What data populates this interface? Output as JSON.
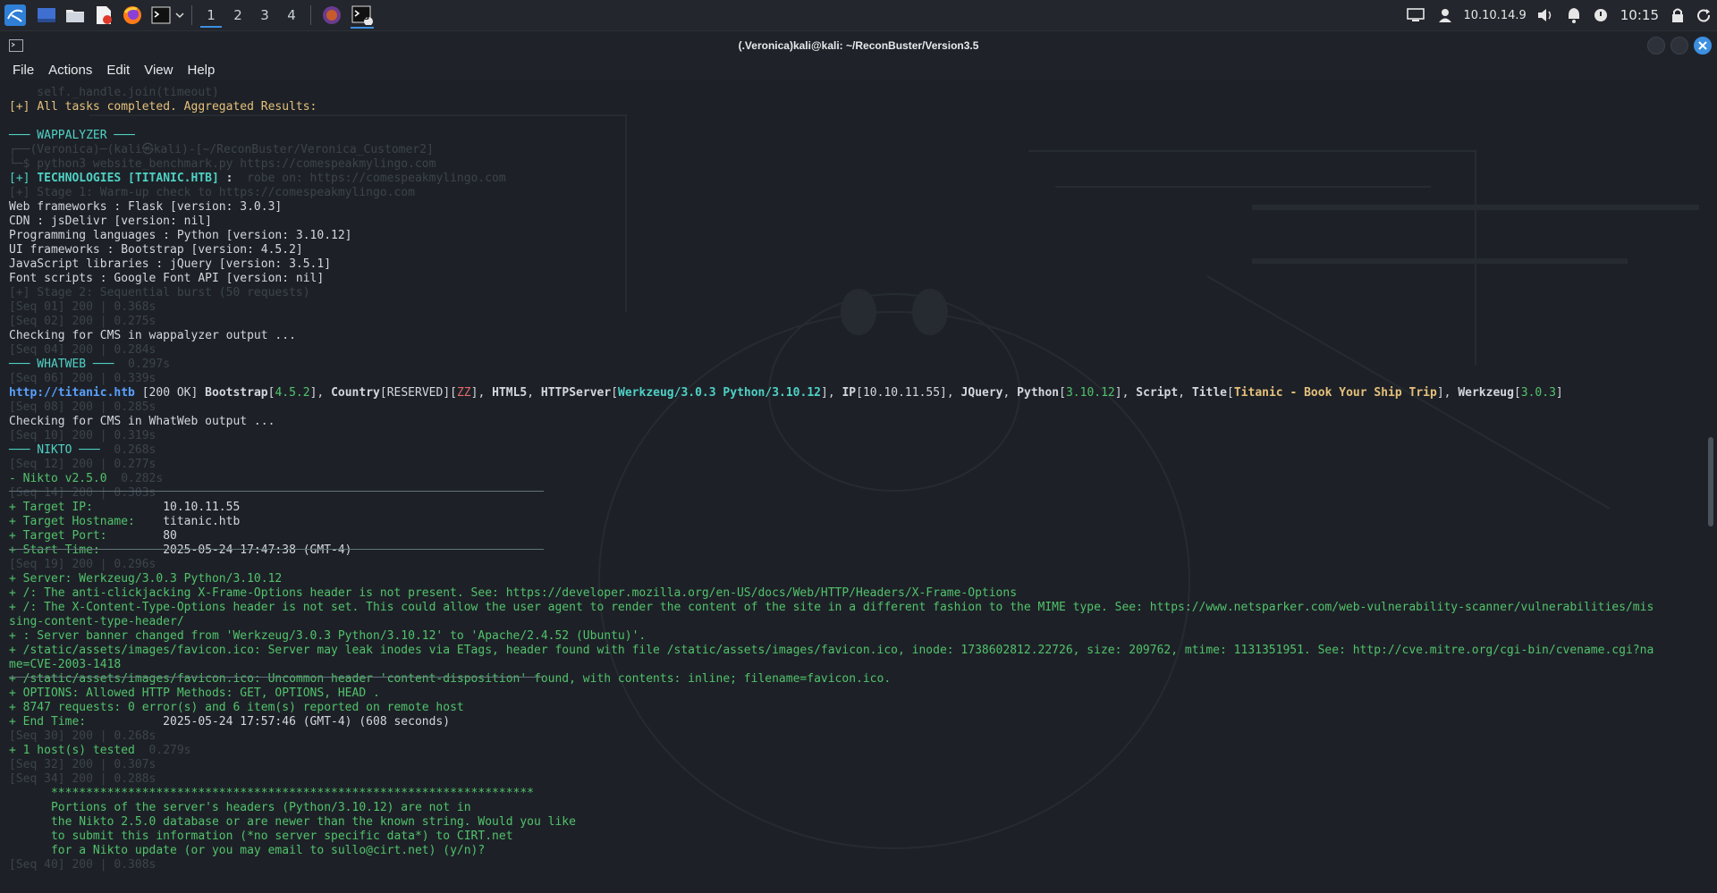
{
  "panel": {
    "workspaces": [
      "1",
      "2",
      "3",
      "4"
    ],
    "active_workspace": "1",
    "terminal_badge": "3",
    "ip": "10.10.14.9",
    "clock": "10:15"
  },
  "window": {
    "title": "(.Veronica)kali@kali: ~/ReconBuster/Version3.5"
  },
  "menu": [
    "File",
    "Actions",
    "Edit",
    "View",
    "Help"
  ],
  "colors": {
    "green": "#52c26b",
    "blue": "#5aa0ff",
    "accent": "#3d8fe0",
    "ghost": "#3c434c"
  },
  "terminal": {
    "lines": [
      {
        "ghost": "    self._handle.join(timeout)"
      },
      {
        "parts": [
          {
            "t": "[+] ",
            "c": "y"
          },
          {
            "t": "All tasks completed. Aggregated Results:",
            "c": "y"
          }
        ]
      },
      {
        "parts": []
      },
      {
        "parts": [
          {
            "t": "─── WAPPALYZER ───",
            "c": "c"
          }
        ]
      },
      {
        "ghost": "┌──(Veronica)─(kali㉿kali)-[~/ReconBuster/Veronica_Customer2]"
      },
      {
        "ghost": "└─$ python3 website_benchmark.py https://comespeakmylingo.com"
      },
      {
        "parts": [
          {
            "t": "[+] ",
            "c": "c"
          },
          {
            "t": "TECHNOLOGIES [TITANIC.HTB] ",
            "c": "c bold"
          },
          {
            "t": ":",
            "c": "bold"
          }
        ],
        "ghost_tail": "  robe on: https://comespeakmylingo.com"
      },
      {
        "ghost": "[+] Stage 1: Warm-up check to https://comespeakmylingo.com"
      },
      {
        "parts": [
          {
            "t": "Web frameworks : Flask [version: 3.0.3]",
            "c": ""
          }
        ]
      },
      {
        "parts": [
          {
            "t": "CDN : jsDelivr [version: nil]",
            "c": ""
          }
        ]
      },
      {
        "parts": [
          {
            "t": "Programming languages : Python [version: 3.10.12]",
            "c": ""
          }
        ]
      },
      {
        "parts": [
          {
            "t": "UI frameworks : Bootstrap [version: 4.5.2]",
            "c": ""
          }
        ]
      },
      {
        "parts": [
          {
            "t": "JavaScript libraries : jQuery [version: 3.5.1]",
            "c": ""
          }
        ]
      },
      {
        "parts": [
          {
            "t": "Font scripts : Google Font API [version: nil]",
            "c": ""
          }
        ]
      },
      {
        "ghost": "[+] Stage 2: Sequential burst (50 requests)"
      },
      {
        "ghost": "[Seq 01] 200 | 0.368s"
      },
      {
        "ghost": "[Seq 02] 200 | 0.275s"
      },
      {
        "parts": [
          {
            "t": "Checking for CMS in wappalyzer output ...",
            "c": ""
          }
        ]
      },
      {
        "ghost": "[Seq 04] 200 | 0.284s"
      },
      {
        "parts": [
          {
            "t": "─── WHATWEB ───",
            "c": "c"
          }
        ],
        "ghost_tail": "  0.297s"
      },
      {
        "ghost": "[Seq 06] 200 | 0.339s"
      },
      {
        "whatweb": true
      },
      {
        "ghost": "[Seq 08] 200 | 0.285s"
      },
      {
        "parts": [
          {
            "t": "Checking for CMS in WhatWeb output ...",
            "c": ""
          }
        ]
      },
      {
        "ghost": "[Seq 10] 200 | 0.319s"
      },
      {
        "parts": [
          {
            "t": "─── NIKTO ───",
            "c": "c"
          }
        ],
        "ghost_tail": "  0.268s"
      },
      {
        "ghost": "[Seq 12] 200 | 0.277s"
      },
      {
        "parts": [
          {
            "t": "- Nikto v2.5.0",
            "c": "g"
          }
        ],
        "ghost_tail": "  0.282s"
      },
      {
        "ghost": "[Seq 14] 200 | 0.303s"
      },
      {
        "parts": [
          {
            "t": "+ Target IP:",
            "c": "g"
          },
          {
            "t": "          10.10.11.55",
            "c": ""
          }
        ]
      },
      {
        "parts": [
          {
            "t": "+ Target Hostname:",
            "c": "g"
          },
          {
            "t": "    titanic.htb",
            "c": ""
          }
        ]
      },
      {
        "parts": [
          {
            "t": "+ Target Port:",
            "c": "g"
          },
          {
            "t": "        80",
            "c": ""
          }
        ]
      },
      {
        "parts": [
          {
            "t": "+ Start Time:",
            "c": "g"
          },
          {
            "t": "         2025-05-24 17:47:38 (GMT-4)",
            "c": ""
          }
        ]
      },
      {
        "ghost": "[Seq 19] 200 | 0.296s"
      },
      {
        "parts": [
          {
            "t": "+ Server: Werkzeug/3.0.3 Python/3.10.12",
            "c": "g"
          }
        ]
      },
      {
        "parts": [
          {
            "t": "+ /: The anti-clickjacking X-Frame-Options header is not present. See: https://developer.mozilla.org/en-US/docs/Web/HTTP/Headers/X-Frame-Options",
            "c": "g"
          }
        ]
      },
      {
        "parts": [
          {
            "t": "+ /: The X-Content-Type-Options header is not set. This could allow the user agent to render the content of the site in a different fashion to the MIME type. See: https://www.netsparker.com/web-vulnerability-scanner/vulnerabilities/mis",
            "c": "g"
          }
        ]
      },
      {
        "parts": [
          {
            "t": "sing-content-type-header/",
            "c": "g"
          }
        ]
      },
      {
        "parts": [
          {
            "t": "+ : Server banner changed from 'Werkzeug/3.0.3 Python/3.10.12' to 'Apache/2.4.52 (Ubuntu)'.",
            "c": "g"
          }
        ]
      },
      {
        "parts": [
          {
            "t": "+ /static/assets/images/favicon.ico: Server may leak inodes via ETags, header found with file /static/assets/images/favicon.ico, inode: 1738602812.22726, size: 209762, mtime: 1131351951. See: http://cve.mitre.org/cgi-bin/cvename.cgi?na",
            "c": "g"
          }
        ]
      },
      {
        "parts": [
          {
            "t": "me=CVE-2003-1418",
            "c": "g"
          }
        ]
      },
      {
        "parts": [
          {
            "t": "+ /static/assets/images/favicon.ico: Uncommon header 'content-disposition' found, with contents: inline; filename=favicon.ico.",
            "c": "g"
          }
        ]
      },
      {
        "parts": [
          {
            "t": "+ OPTIONS: Allowed HTTP Methods: GET, OPTIONS, HEAD .",
            "c": "g"
          }
        ]
      },
      {
        "parts": [
          {
            "t": "+ 8747 requests: 0 error(s) and 6 item(s) reported on remote host",
            "c": "g"
          }
        ]
      },
      {
        "parts": [
          {
            "t": "+ End Time:",
            "c": "g"
          },
          {
            "t": "           2025-05-24 17:57:46 (GMT-4) (608 seconds)",
            "c": ""
          }
        ]
      },
      {
        "ghost": "[Seq 30] 200 | 0.268s"
      },
      {
        "parts": [
          {
            "t": "+ 1 host(s) tested",
            "c": "g"
          }
        ],
        "ghost_tail": "  0.279s"
      },
      {
        "ghost": "[Seq 32] 200 | 0.307s"
      },
      {
        "ghost": "[Seq 34] 200 | 0.288s"
      },
      {
        "parts": [
          {
            "t": "      *********************************************************************",
            "c": "g"
          }
        ]
      },
      {
        "parts": [
          {
            "t": "      Portions of the server's headers (Python/3.10.12) are not in",
            "c": "g"
          }
        ]
      },
      {
        "parts": [
          {
            "t": "      the Nikto 2.5.0 database or are newer than the known string. Would you like",
            "c": "g"
          }
        ]
      },
      {
        "parts": [
          {
            "t": "      to submit this information (*no server specific data*) to CIRT.net",
            "c": "g"
          }
        ]
      },
      {
        "parts": [
          {
            "t": "      for a Nikto update (or you may email to sullo@cirt.net) (y/n)?",
            "c": "g"
          }
        ]
      },
      {
        "ghost": "[Seq 40] 200 | 0.308s"
      }
    ],
    "whatweb": [
      {
        "t": "http://titanic.htb",
        "c": "b"
      },
      {
        "t": " [200 OK] ",
        "c": ""
      },
      {
        "t": "Bootstrap",
        "c": "bold"
      },
      {
        "t": "[",
        "c": ""
      },
      {
        "t": "4.5.2",
        "c": "g"
      },
      {
        "t": "], ",
        "c": ""
      },
      {
        "t": "Country",
        "c": "bold"
      },
      {
        "t": "[RESERVED][",
        "c": ""
      },
      {
        "t": "ZZ",
        "c": "r"
      },
      {
        "t": "], ",
        "c": ""
      },
      {
        "t": "HTML5",
        "c": "bold"
      },
      {
        "t": ", ",
        "c": ""
      },
      {
        "t": "HTTPServer",
        "c": "bold"
      },
      {
        "t": "[",
        "c": ""
      },
      {
        "t": "Werkzeug/3.0.3 Python/3.10.12",
        "c": "c bold"
      },
      {
        "t": "], ",
        "c": ""
      },
      {
        "t": "IP",
        "c": "bold"
      },
      {
        "t": "[10.10.11.55], ",
        "c": ""
      },
      {
        "t": "JQuery",
        "c": "bold"
      },
      {
        "t": ", ",
        "c": ""
      },
      {
        "t": "Python",
        "c": "bold"
      },
      {
        "t": "[",
        "c": ""
      },
      {
        "t": "3.10.12",
        "c": "g"
      },
      {
        "t": "], ",
        "c": ""
      },
      {
        "t": "Script",
        "c": "bold"
      },
      {
        "t": ", ",
        "c": ""
      },
      {
        "t": "Title",
        "c": "bold"
      },
      {
        "t": "[",
        "c": ""
      },
      {
        "t": "Titanic - Book Your Ship Trip",
        "c": "y bold"
      },
      {
        "t": "], ",
        "c": ""
      },
      {
        "t": "Werkzeug",
        "c": "bold"
      },
      {
        "t": "[",
        "c": ""
      },
      {
        "t": "3.0.3",
        "c": "g"
      },
      {
        "t": "]",
        "c": ""
      }
    ]
  }
}
